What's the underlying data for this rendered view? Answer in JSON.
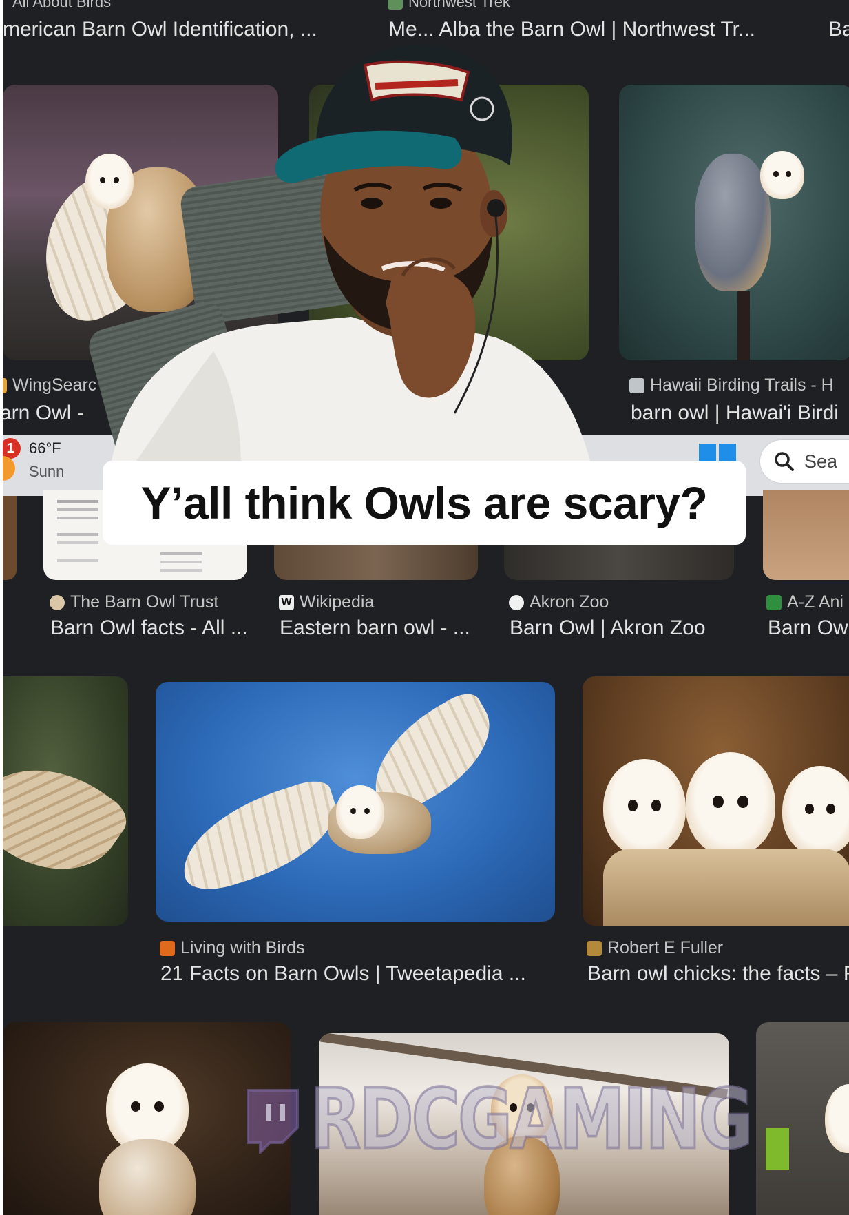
{
  "results_top": [
    {
      "source": "All About Birds",
      "title": "merican Barn Owl Identification, ..."
    },
    {
      "source": "Northwest Trek",
      "title": "Me... Alba the Barn Owl | Northwest Tr..."
    },
    {
      "source": "",
      "title": "Ba"
    }
  ],
  "results_mid": [
    {
      "source": "WingSearc",
      "title": "arn Owl - "
    },
    {
      "source": "Hawaii Birding Trails - H",
      "title": "barn owl | Hawai'i Birdi"
    }
  ],
  "results_row3": [
    {
      "source": "The Barn Owl Trust",
      "title": "Barn Owl facts - All ..."
    },
    {
      "source": "Wikipedia",
      "title": "Eastern barn owl - ..."
    },
    {
      "source": "Akron Zoo",
      "title": "Barn Owl | Akron Zoo"
    },
    {
      "source": "A-Z Ani",
      "title": "Barn Owl"
    }
  ],
  "results_row4": [
    {
      "source": "Living with Birds",
      "title": "21 Facts on Barn Owls | Tweetapedia ..."
    },
    {
      "source": "Robert E Fuller",
      "title": "Barn owl chicks: the facts – R"
    }
  ],
  "weather": {
    "badge": "1",
    "temp": "66°F",
    "condition": "Sunn"
  },
  "search": {
    "label": "Sea"
  },
  "caption": "Y’all think Owls are scary?",
  "watermark": {
    "channel": "RDCGAMING"
  },
  "colors": {
    "page_bg": "#1f2023",
    "caption_bg": "#ffffff",
    "caption_text": "#111111"
  }
}
